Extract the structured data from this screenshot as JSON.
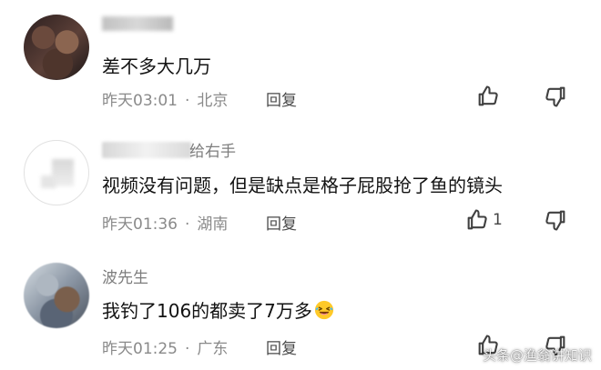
{
  "comments": [
    {
      "username": "",
      "content": "差不多大几万",
      "time": "昨天03:01",
      "location": "北京",
      "reply": "回复"
    },
    {
      "username_suffix": "给右手",
      "content": "视频没有问题，但是缺点是格子屁股抢了鱼的镜头",
      "time": "昨天01:36",
      "location": "湖南",
      "reply": "回复",
      "like_count": "1"
    },
    {
      "username": "波先生",
      "content": "我钓了106的都卖了7万多",
      "time": "昨天01:25",
      "location": "广东",
      "reply": "回复"
    }
  ],
  "watermark": "头条@渔翁讲知识",
  "icons": {
    "like": "thumb-up-icon",
    "dislike": "thumb-down-icon",
    "emoji": "laughing-emoji-icon"
  }
}
